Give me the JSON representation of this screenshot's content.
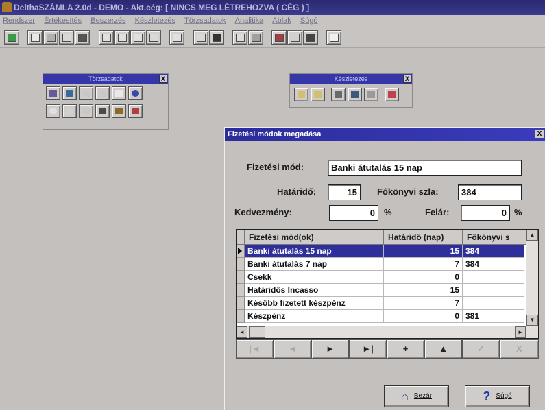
{
  "window": {
    "title": "DelthaSZÁMLA 2.0d  - DEMO -  Akt.cég: [ NINCS MEG LÉTREHOZVA ( CÉG ) ]"
  },
  "menu": [
    "Rendszer",
    "Értékesítés",
    "Beszerzés",
    "Készletezés",
    "Törzsadatok",
    "Analitika",
    "Ablak",
    "Súgó"
  ],
  "palettes": {
    "torzsadatok_title": "Törzsadatok",
    "keszletezes_title": "Készletezés",
    "close_glyph": "X"
  },
  "dialog": {
    "title": "Fizetési módok megadása",
    "close_glyph": "X",
    "fields": {
      "fizetesi_mod_label": "Fizetési mód:",
      "fizetesi_mod_value": "Banki átutalás 15 nap",
      "hatarido_label": "Határidő:",
      "hatarido_value": "15",
      "fokonyvi_label": "Főkönyvi szla:",
      "fokonyvi_value": "384",
      "kedvezmeny_label": "Kedvezmény:",
      "kedvezmeny_value": "0",
      "kedvezmeny_unit": "%",
      "felar_label": "Felár:",
      "felar_value": "0",
      "felar_unit": "%"
    },
    "grid": {
      "columns": [
        "Fizetési mód(ok)",
        "Határidő (nap)",
        "Főkönyvi s"
      ],
      "rows": [
        {
          "mod": "Banki átutalás 15 nap",
          "hatarido": "15",
          "fokonyvi": "384",
          "selected": true
        },
        {
          "mod": "Banki átutalás 7 nap",
          "hatarido": "7",
          "fokonyvi": "384",
          "selected": false
        },
        {
          "mod": "Csekk",
          "hatarido": "0",
          "fokonyvi": "",
          "selected": false
        },
        {
          "mod": "Határidős Incasso",
          "hatarido": "15",
          "fokonyvi": "",
          "selected": false
        },
        {
          "mod": "Később fizetett készpénz",
          "hatarido": "7",
          "fokonyvi": "",
          "selected": false
        },
        {
          "mod": "Készpénz",
          "hatarido": "0",
          "fokonyvi": "381",
          "selected": false
        }
      ]
    },
    "navigator": [
      "|◄",
      "◄",
      "►",
      "►|",
      "+",
      "▲",
      "✓",
      "X"
    ],
    "buttons": {
      "close_label": "Bezár",
      "help_label": "Súgó",
      "help_glyph": "?"
    }
  },
  "colors": {
    "title_bar": "#2a2970",
    "dialog_title": "#2b2c9a",
    "selection": "#2e2f9a",
    "face": "#c4c0bd"
  }
}
